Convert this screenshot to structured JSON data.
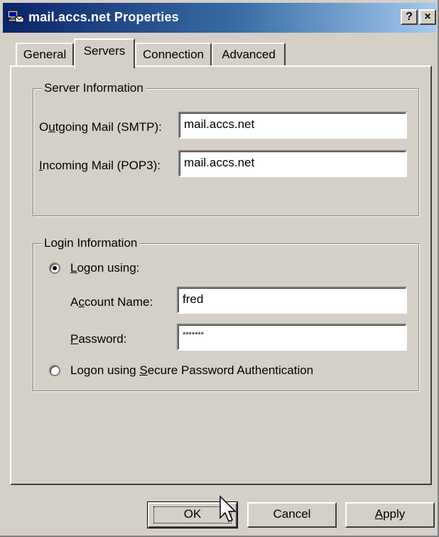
{
  "window": {
    "title": "mail.accs.net Properties",
    "help_button": "?",
    "close_button": "×",
    "title_bar_color": "#0a246a"
  },
  "tabs": [
    {
      "label": "General",
      "active": false
    },
    {
      "label": "Servers",
      "active": true
    },
    {
      "label": "Connection",
      "active": false
    },
    {
      "label": "Advanced",
      "active": false
    }
  ],
  "server_info": {
    "legend": "Server Information",
    "outgoing": {
      "label_pre": "O",
      "label_key": "u",
      "label_post": "tgoing Mail (SMTP):",
      "value": "mail.accs.net"
    },
    "incoming": {
      "label_pre": "",
      "label_key": "I",
      "label_post": "ncoming Mail (POP3):",
      "value": "mail.accs.net"
    }
  },
  "login_info": {
    "legend": "Login Information",
    "logon_using": {
      "label_key": "L",
      "label_post": "ogon using:",
      "selected": true
    },
    "account": {
      "label_pre": "A",
      "label_key": "c",
      "label_post": "count Name:",
      "value": "fred"
    },
    "password": {
      "label_key": "P",
      "label_post": "assword:",
      "value": "*******"
    },
    "spa": {
      "label_pre": "Logon using ",
      "label_key": "S",
      "label_post": "ecure Password Authentication",
      "selected": false
    }
  },
  "buttons": {
    "ok": "OK",
    "cancel": "Cancel",
    "apply_key": "A",
    "apply_post": "pply"
  }
}
